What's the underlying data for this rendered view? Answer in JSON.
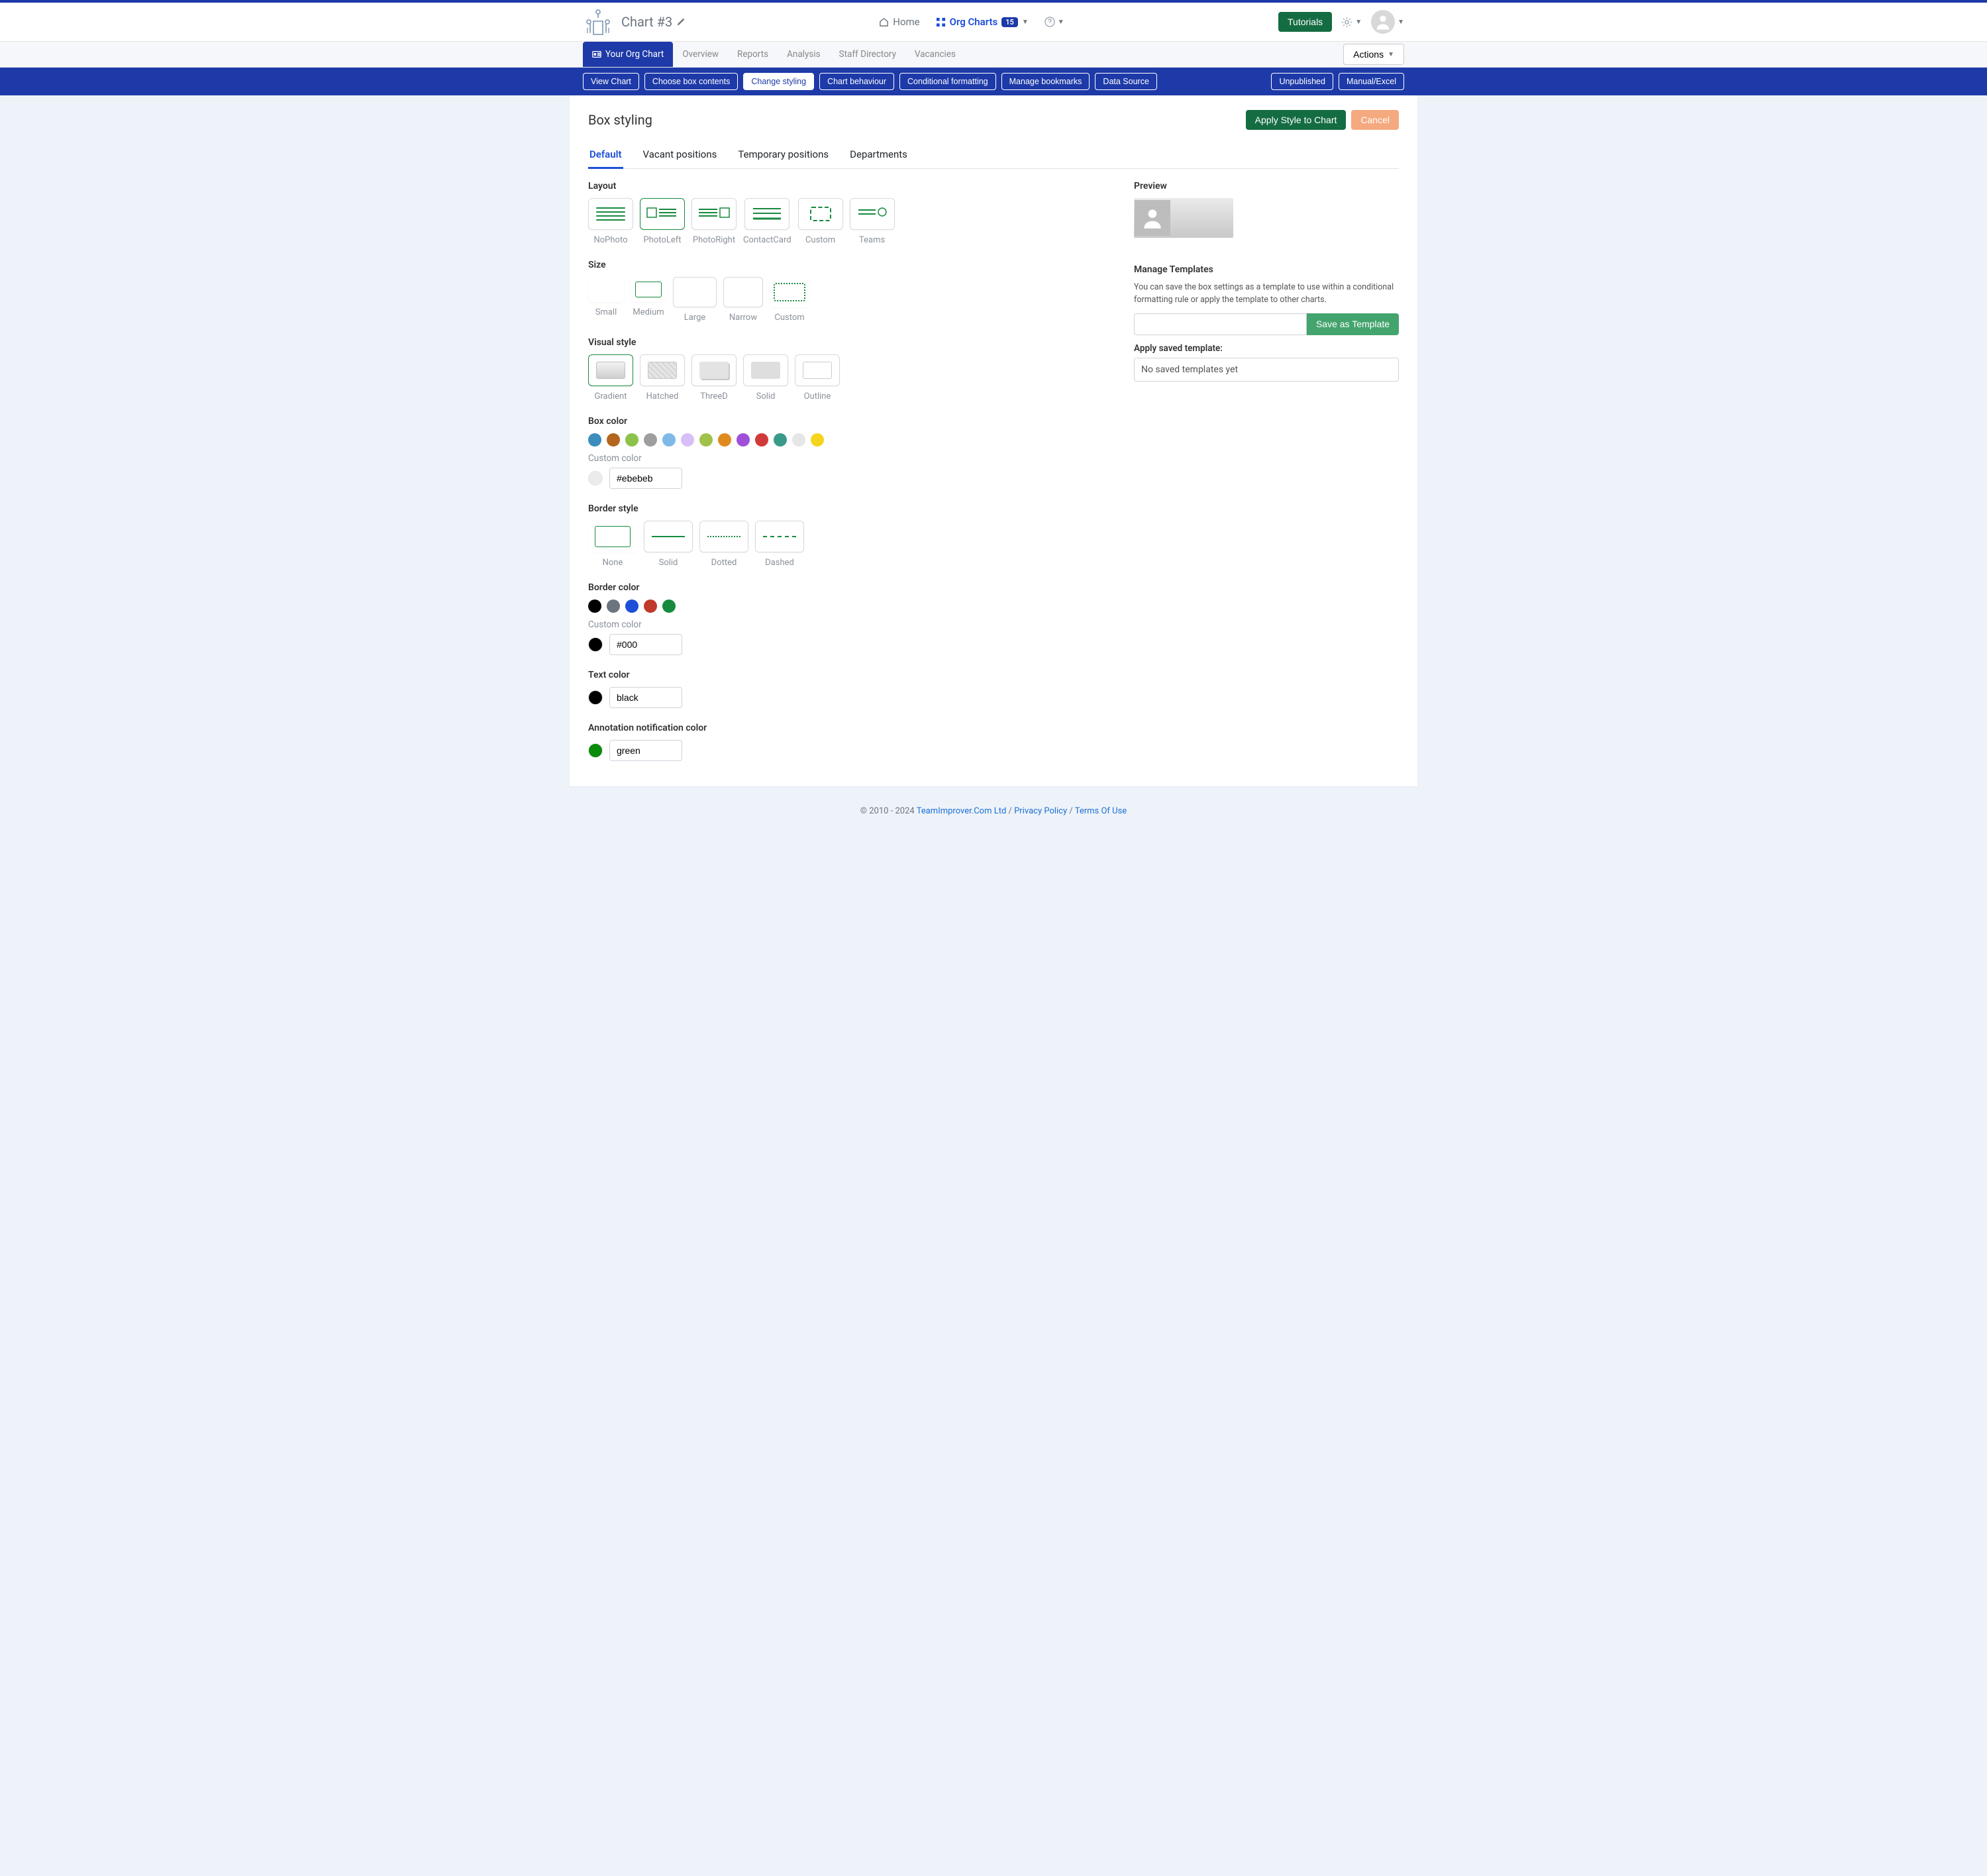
{
  "header": {
    "chart_title": "Chart #3",
    "nav": {
      "home": "Home",
      "org_charts": "Org Charts",
      "org_charts_count": "15"
    },
    "tutorials_btn": "Tutorials"
  },
  "main_tabs": {
    "your_org_chart": "Your Org Chart",
    "overview": "Overview",
    "reports": "Reports",
    "analysis": "Analysis",
    "staff_directory": "Staff Directory",
    "vacancies": "Vacancies",
    "actions_btn": "Actions"
  },
  "subnav": {
    "view_chart": "View Chart",
    "choose_box_contents": "Choose box contents",
    "change_styling": "Change styling",
    "chart_behaviour": "Chart behaviour",
    "conditional_formatting": "Conditional formatting",
    "manage_bookmarks": "Manage bookmarks",
    "data_source": "Data Source",
    "unpublished": "Unpublished",
    "manual_excel": "Manual/Excel"
  },
  "page": {
    "title": "Box styling",
    "apply_btn": "Apply Style to Chart",
    "cancel_btn": "Cancel"
  },
  "style_tabs": {
    "default": "Default",
    "vacant": "Vacant positions",
    "temporary": "Temporary positions",
    "departments": "Departments"
  },
  "sections": {
    "layout": {
      "label": "Layout",
      "options": {
        "nophoto": "NoPhoto",
        "photoleft": "PhotoLeft",
        "photoright": "PhotoRight",
        "contactcard": "ContactCard",
        "custom": "Custom",
        "teams": "Teams"
      }
    },
    "size": {
      "label": "Size",
      "options": {
        "small": "Small",
        "medium": "Medium",
        "large": "Large",
        "narrow": "Narrow",
        "custom": "Custom"
      }
    },
    "visual_style": {
      "label": "Visual style",
      "options": {
        "gradient": "Gradient",
        "hatched": "Hatched",
        "threed": "ThreeD",
        "solid": "Solid",
        "outline": "Outline"
      }
    },
    "box_color": {
      "label": "Box color",
      "custom_label": "Custom color",
      "value": "#ebebeb",
      "swatches": [
        "#3c8dbc",
        "#b5651d",
        "#8bc34a",
        "#9e9e9e",
        "#7eb9e8",
        "#d8bff7",
        "#a0c24a",
        "#e08a1e",
        "#a050d8",
        "#d03a3a",
        "#3a9a8a",
        "#e6e6e6",
        "#f5d41f"
      ]
    },
    "border_style": {
      "label": "Border style",
      "options": {
        "none": "None",
        "solid": "Solid",
        "dotted": "Dotted",
        "dashed": "Dashed"
      }
    },
    "border_color": {
      "label": "Border color",
      "custom_label": "Custom color",
      "value": "#000",
      "swatches": [
        "#000000",
        "#6c757d",
        "#1d4ed8",
        "#c0392b",
        "#178a3e"
      ]
    },
    "text_color": {
      "label": "Text color",
      "value": "black"
    },
    "annotation_color": {
      "label": "Annotation notification color",
      "value": "green"
    }
  },
  "right_panel": {
    "preview_label": "Preview",
    "manage_label": "Manage Templates",
    "manage_desc": "You can save the box settings as a template to use within a conditional formatting rule or apply the template to other charts.",
    "save_btn": "Save as Template",
    "apply_label": "Apply saved template:",
    "no_templates": "No saved templates yet"
  },
  "footer": {
    "copyright": "© 2010 - 2024 ",
    "company": "TeamImprover.Com Ltd",
    "privacy": "Privacy Policy",
    "terms": "Terms Of Use"
  }
}
